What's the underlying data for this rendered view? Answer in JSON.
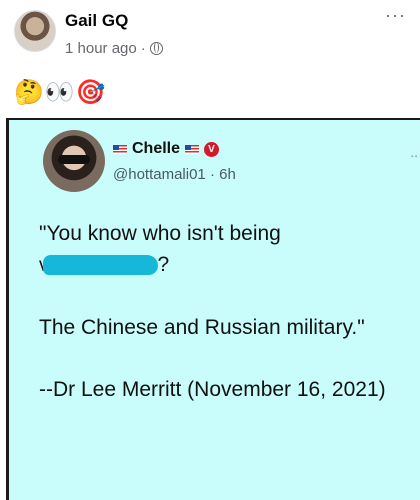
{
  "post": {
    "author": "Gail GQ",
    "time": "1 hour ago",
    "separator": "·",
    "emojis": "🤔👀🎯",
    "more": "···"
  },
  "tweet": {
    "name": "Chelle",
    "handle": "@hottamali01",
    "time": "· 6h",
    "more": "..",
    "verified_mark": "V",
    "line1": "\"You know who isn't being",
    "line2_start": "v",
    "line2_end": "?",
    "line3": "The Chinese and Russian military.\"",
    "line4": "--Dr Lee Merritt (November 16, 2021)"
  }
}
